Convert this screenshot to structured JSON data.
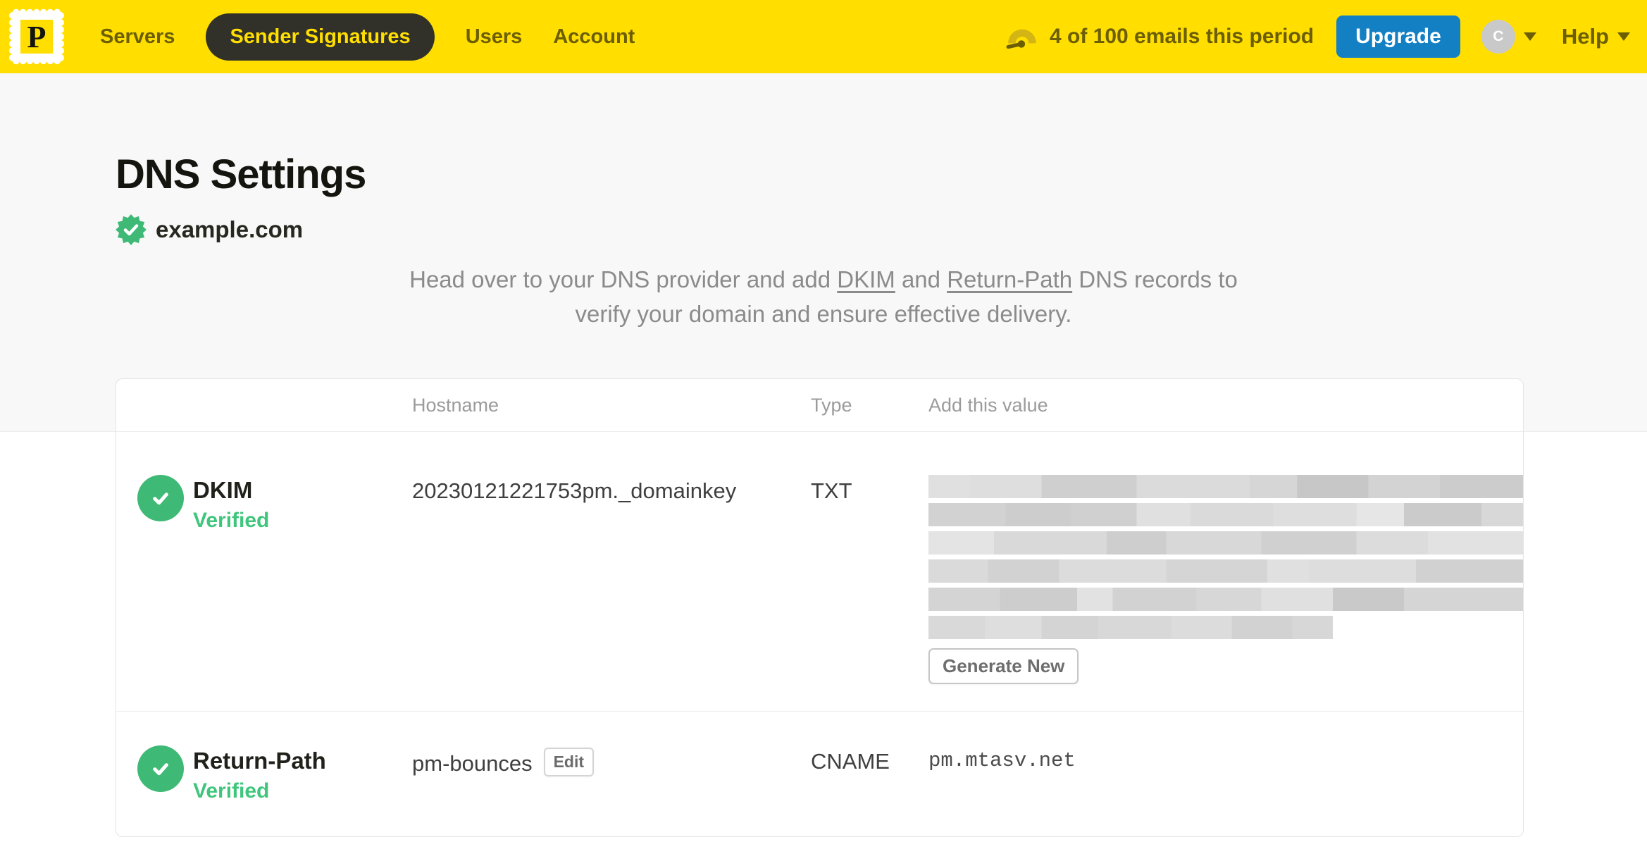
{
  "nav": {
    "logo_letter": "P",
    "items": [
      {
        "label": "Servers",
        "active": false
      },
      {
        "label": "Sender Signatures",
        "active": true
      },
      {
        "label": "Users",
        "active": false
      },
      {
        "label": "Account",
        "active": false
      }
    ],
    "usage_text": "4 of 100 emails this period",
    "upgrade_label": "Upgrade",
    "avatar_letter": "C",
    "help_label": "Help"
  },
  "page": {
    "title": "DNS Settings",
    "domain": "example.com",
    "description": {
      "part1": "Head over to your DNS provider and add ",
      "link1": "DKIM",
      "part2": " and ",
      "link2": "Return-Path",
      "part3": " DNS records to",
      "part4": "verify your domain and ensure effective delivery."
    }
  },
  "table": {
    "headers": {
      "hostname": "Hostname",
      "type": "Type",
      "value": "Add this value"
    },
    "rows": [
      {
        "name": "DKIM",
        "status": "Verified",
        "hostname": "20230121221753pm._domainkey",
        "type": "TXT",
        "value_redacted": true,
        "action_label": "Generate New"
      },
      {
        "name": "Return-Path",
        "status": "Verified",
        "hostname": "pm-bounces",
        "edit_label": "Edit",
        "type": "CNAME",
        "value": "pm.mtasv.net"
      }
    ]
  },
  "colors": {
    "brand_yellow": "#ffde00",
    "nav_text": "#6b5e03",
    "active_pill": "#31312a",
    "upgrade_blue": "#1480c4",
    "verified_green": "#3fb976",
    "verified_text_green": "#3fc67c"
  }
}
